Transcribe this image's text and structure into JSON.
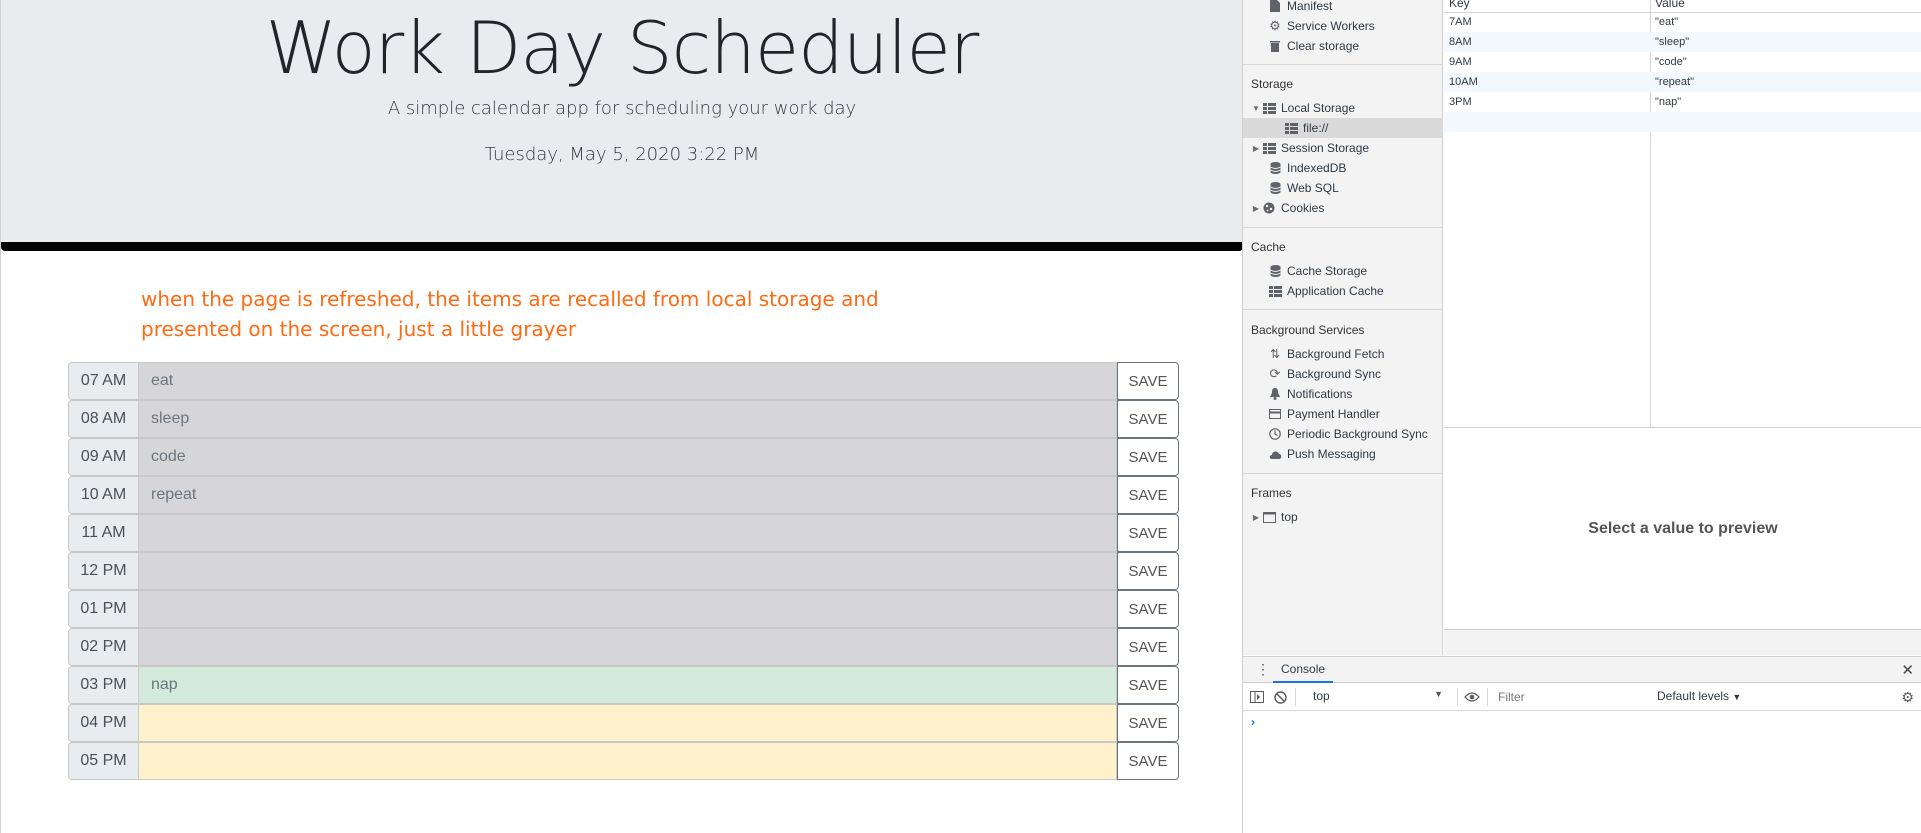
{
  "app": {
    "title": "Work Day Scheduler",
    "lead": "A simple calendar app for scheduling your work day",
    "current_day": "Tuesday, May 5, 2020 3:22 PM",
    "annotation_line1": "when the page is refreshed, the items are recalled from local storage and",
    "annotation_line2": "presented on the screen, just a little grayer",
    "save_label": "SAVE",
    "rows": [
      {
        "hour": "07 AM",
        "text": "eat",
        "state": "past"
      },
      {
        "hour": "08 AM",
        "text": "sleep",
        "state": "past"
      },
      {
        "hour": "09 AM",
        "text": "code",
        "state": "past"
      },
      {
        "hour": "10 AM",
        "text": "repeat",
        "state": "past"
      },
      {
        "hour": "11 AM",
        "text": "",
        "state": "past"
      },
      {
        "hour": "12 PM",
        "text": "",
        "state": "past"
      },
      {
        "hour": "01 PM",
        "text": "",
        "state": "past"
      },
      {
        "hour": "02 PM",
        "text": "",
        "state": "past"
      },
      {
        "hour": "03 PM",
        "text": "nap",
        "state": "present"
      },
      {
        "hour": "04 PM",
        "text": "",
        "state": "future"
      },
      {
        "hour": "05 PM",
        "text": "",
        "state": "future"
      }
    ],
    "colors": {
      "past": "#d6d6d8",
      "present": "#d4ebdc",
      "future": "#fff1cc",
      "annotation": "#ff6a13"
    }
  },
  "devtools": {
    "sidebar": {
      "application_items": [
        {
          "label": "Manifest",
          "icon": "file-icon"
        },
        {
          "label": "Service Workers",
          "icon": "gear-icon"
        },
        {
          "label": "Clear storage",
          "icon": "trash-icon"
        }
      ],
      "storage_header": "Storage",
      "storage_items": [
        {
          "label": "Local Storage",
          "icon": "grid-icon",
          "expanded": true
        },
        {
          "label": "file://",
          "icon": "grid-icon",
          "selected": true
        },
        {
          "label": "Session Storage",
          "icon": "grid-icon",
          "expanded": false
        },
        {
          "label": "IndexedDB",
          "icon": "database-icon"
        },
        {
          "label": "Web SQL",
          "icon": "database-icon"
        },
        {
          "label": "Cookies",
          "icon": "cookie-icon",
          "expanded": false
        }
      ],
      "cache_header": "Cache",
      "cache_items": [
        {
          "label": "Cache Storage",
          "icon": "database-icon"
        },
        {
          "label": "Application Cache",
          "icon": "grid-icon"
        }
      ],
      "bg_header": "Background Services",
      "bg_items": [
        {
          "label": "Background Fetch",
          "icon": "arrows-updown-icon"
        },
        {
          "label": "Background Sync",
          "icon": "sync-icon"
        },
        {
          "label": "Notifications",
          "icon": "bell-icon"
        },
        {
          "label": "Payment Handler",
          "icon": "card-icon"
        },
        {
          "label": "Periodic Background Sync",
          "icon": "clock-icon"
        },
        {
          "label": "Push Messaging",
          "icon": "cloud-icon"
        }
      ],
      "frames_header": "Frames",
      "frames_items": [
        {
          "label": "top",
          "icon": "window-icon",
          "expanded": false
        }
      ]
    },
    "table": {
      "key_header": "Key",
      "value_header": "Value",
      "rows": [
        {
          "key": "7AM",
          "value": "\"eat\""
        },
        {
          "key": "8AM",
          "value": "\"sleep\""
        },
        {
          "key": "9AM",
          "value": "\"code\""
        },
        {
          "key": "10AM",
          "value": "\"repeat\""
        },
        {
          "key": "3PM",
          "value": "\"nap\""
        }
      ]
    },
    "preview_text": "Select a value to preview",
    "console": {
      "tab_label": "Console",
      "context": "top",
      "filter_placeholder": "Filter",
      "levels": "Default levels",
      "prompt": "›"
    }
  }
}
